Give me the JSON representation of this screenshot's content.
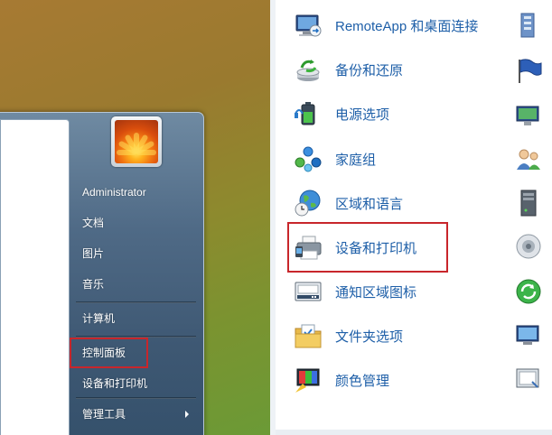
{
  "start_menu": {
    "user_name": "Administrator",
    "items": [
      {
        "label": "文档"
      },
      {
        "label": "图片"
      },
      {
        "label": "音乐"
      },
      {
        "label": "计算机"
      },
      {
        "label": "控制面板"
      },
      {
        "label": "设备和打印机"
      },
      {
        "label": "管理工具"
      }
    ]
  },
  "control_panel": {
    "items": [
      {
        "label": "RemoteApp 和桌面连接",
        "icon": "remoteapp-icon"
      },
      {
        "label": "备份和还原",
        "icon": "backup-icon"
      },
      {
        "label": "电源选项",
        "icon": "power-options-icon"
      },
      {
        "label": "家庭组",
        "icon": "homegroup-icon"
      },
      {
        "label": "区域和语言",
        "icon": "region-language-icon"
      },
      {
        "label": "设备和打印机",
        "icon": "devices-printers-icon"
      },
      {
        "label": "通知区域图标",
        "icon": "notification-area-icon"
      },
      {
        "label": "文件夹选项",
        "icon": "folder-options-icon"
      },
      {
        "label": "颜色管理",
        "icon": "color-management-icon"
      }
    ]
  },
  "colors": {
    "highlight_border": "#c8262b",
    "link_color": "#1e5fa8"
  }
}
